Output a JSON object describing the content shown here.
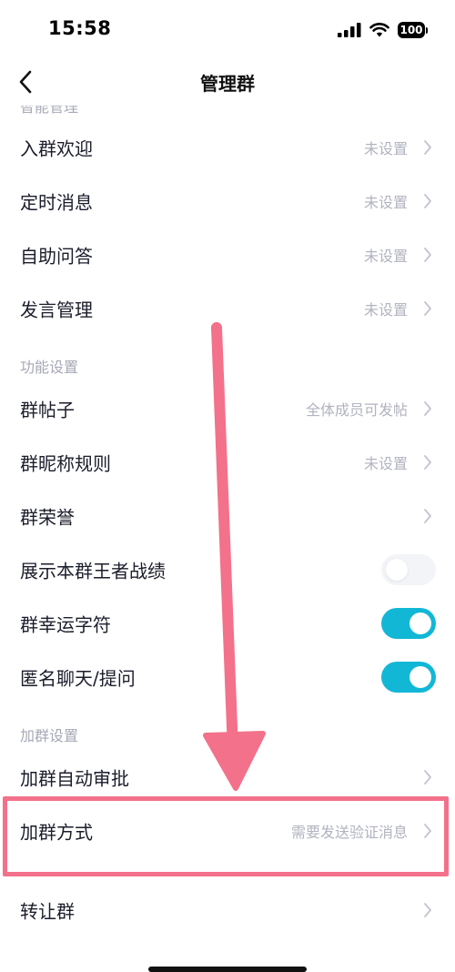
{
  "status_bar": {
    "time": "15:58",
    "battery": "100"
  },
  "nav": {
    "title": "管理群"
  },
  "cut_section_header": "智能管理",
  "sections": [
    {
      "header": "功能设置"
    },
    {
      "header": "加群设置"
    }
  ],
  "rows": {
    "join_welcome": {
      "label": "入群欢迎",
      "value": "未设置"
    },
    "scheduled_message": {
      "label": "定时消息",
      "value": "未设置"
    },
    "self_qa": {
      "label": "自助问答",
      "value": "未设置"
    },
    "speech_management": {
      "label": "发言管理",
      "value": "未设置"
    },
    "group_posts": {
      "label": "群帖子",
      "value": "全体成员可发帖"
    },
    "nickname_rules": {
      "label": "群昵称规则",
      "value": "未设置"
    },
    "group_honor": {
      "label": "群荣誉"
    },
    "show_game_record": {
      "label": "展示本群王者战绩",
      "toggle": false
    },
    "lucky_character": {
      "label": "群幸运字符",
      "toggle": true
    },
    "anonymous_chat": {
      "label": "匿名聊天/提问",
      "toggle": true
    },
    "auto_approval": {
      "label": "加群自动审批"
    },
    "join_method": {
      "label": "加群方式",
      "value": "需要发送验证消息"
    },
    "transfer_group": {
      "label": "转让群"
    }
  },
  "colors": {
    "accent": "#12b7d6",
    "annotation": "#f3718a"
  },
  "icons": {
    "back": "chevron-left-icon",
    "row_arrow": "chevron-right-icon"
  }
}
